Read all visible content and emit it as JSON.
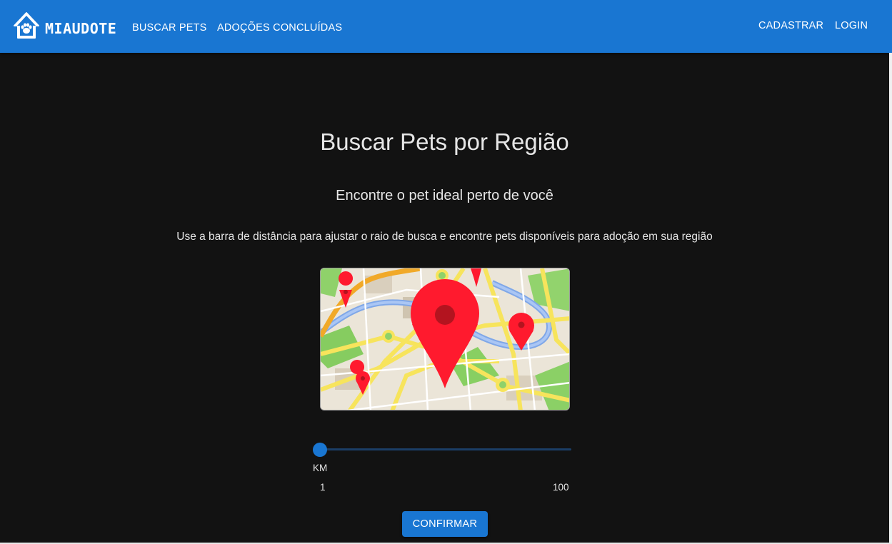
{
  "header": {
    "brand": "MIAUDOTE",
    "logo_icon": "house-paw-icon",
    "nav": [
      {
        "label": "BUSCAR PETS"
      },
      {
        "label": "ADOÇÕES CONCLUÍDAS"
      }
    ],
    "actions": [
      {
        "label": "CADASTRAR"
      },
      {
        "label": "LOGIN"
      }
    ]
  },
  "main": {
    "title": "Buscar Pets por Região",
    "subtitle": "Encontre o pet ideal perto de você",
    "description": "Use a barra de distância para ajustar o raio de busca e encontre pets disponíveis para adoção em sua região",
    "map_icon": "map-pins-illustration",
    "slider": {
      "unit_label": "KM",
      "min": 1,
      "max": 100,
      "value": 1,
      "min_label": "1",
      "max_label": "100"
    },
    "confirm_label": "CONFIRMAR"
  },
  "colors": {
    "primary": "#1976d2",
    "background": "#121212",
    "pin": "#ff1a2e"
  }
}
